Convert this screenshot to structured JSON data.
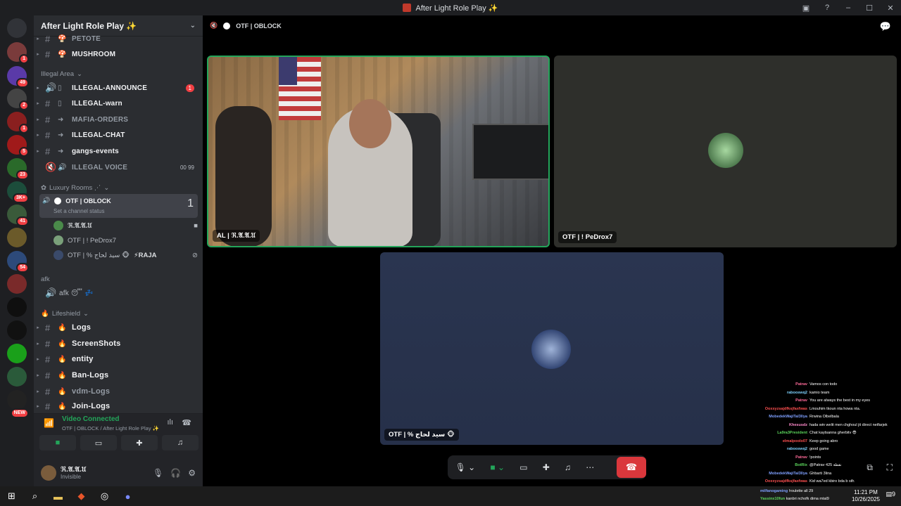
{
  "window": {
    "title": "After Light Role Play ✨"
  },
  "guild": {
    "name": "After Light Role Play ✨"
  },
  "servers": [
    {
      "badge": "1"
    },
    {
      "badge": "49"
    },
    {
      "badge": "2"
    },
    {
      "badge": "1"
    },
    {
      "badge": "5"
    },
    {
      "badge": "23"
    },
    {
      "badge": "3K+"
    },
    {
      "badge": "41"
    },
    {
      "badge": ""
    },
    {
      "badge": "54"
    },
    {
      "badge": ""
    },
    {
      "badge": ""
    },
    {
      "badge": ""
    },
    {
      "badge": ""
    },
    {
      "badge": "NEW"
    }
  ],
  "channels": {
    "top": [
      {
        "emoji": "🍄",
        "name": "PETOTE"
      },
      {
        "emoji": "🍄",
        "name": "MUSHROOM"
      }
    ],
    "illegal_category": "Illegal Area",
    "illegal": [
      {
        "name": "ILLEGAL-ANNOUNCE",
        "count": "1"
      },
      {
        "name": "ILLEGAL-warn",
        "count": ""
      },
      {
        "name": "MAFIA-ORDERS",
        "count": ""
      },
      {
        "name": "ILLEGAL-CHAT",
        "count": ""
      },
      {
        "name": "gangs-events",
        "count": ""
      },
      {
        "name": "ILLEGAL VOICE",
        "count": ""
      }
    ],
    "illegal_voice_counts": [
      "00",
      "99"
    ],
    "luxury_category": "Luxury Rooms ⋰",
    "current_voice": {
      "name": "OTF | OBLOCK",
      "status": "Set a channel status",
      "count": "1"
    },
    "voice_users": [
      {
        "name": "ℜ.𝔄.𝔄.𝔘"
      },
      {
        "name": "OTF | ! PeDrox7"
      },
      {
        "name": "OTF | % سيد لحاج 🐵",
        "extra": "⚡RAJA"
      }
    ],
    "afk_category": "afk",
    "afk": {
      "name": "afk 😴 💤"
    },
    "lifeshield_category": "Lifeshield",
    "lifeshield": [
      {
        "name": "Logs"
      },
      {
        "name": "ScreenShots"
      },
      {
        "name": "entity"
      },
      {
        "name": "Ban-Logs"
      },
      {
        "name": "vdm-Logs"
      },
      {
        "name": "Join-Logs"
      }
    ]
  },
  "voice_panel": {
    "status": "Video Connected",
    "where": "OTF | OBLOCK / After Light Role Play ✨"
  },
  "user": {
    "name": "ℜ.𝔄.𝔄.𝔘",
    "status": "Invisible"
  },
  "stage": {
    "header": "OTF | OBLOCK",
    "tiles": [
      {
        "label": "AL | ℜ.𝔄.𝔄.𝔘"
      },
      {
        "label": "OTF | ! PeDrox7"
      },
      {
        "label": "OTF | % سيد لحاج 🐵"
      }
    ]
  },
  "chat_overlay": [
    {
      "user": "Patrav",
      "text": "Vamos con todo"
    },
    {
      "user": "rabooswq2",
      "text": "kamio team"
    },
    {
      "user": "Patrav",
      "text": "You are always the best in my eyes"
    },
    {
      "user": "Ooxxyzsajdfksjfaxfwas",
      "text": "Lmouhim tkoun nta howa nta."
    },
    {
      "user": "MobedekWajiTal3llya",
      "text": "Rrwina Olbelbala"
    },
    {
      "user": "Khesusdz",
      "text": "hada win welit men chghoul jit direct netfarjek"
    },
    {
      "user": "La9ra3President",
      "text": "Chat kaytsanna gherbitv 😎"
    },
    {
      "user": "elmalpoolo07",
      "text": "Keep going abro"
    },
    {
      "user": "rabooswq2",
      "text": "good game"
    },
    {
      "user": "Patrav",
      "text": "!points"
    },
    {
      "user": "BotRix",
      "text": "@Patrav 425 نقطة"
    },
    {
      "user": "MobedekWajiTal3llya",
      "text": "Ghbarti 3lina"
    },
    {
      "user": "Ooxxyzsajdfksjfaxfwas",
      "text": "Kid wa7ed kbiro bda b sifr."
    },
    {
      "user": "milfanogaming",
      "text": "!roulette all 29"
    },
    {
      "user": "Yassinx10fun",
      "text": "kanbri nchofk dima mtal9"
    }
  ],
  "taskbar": {
    "time": "11:21 PM",
    "date": "10/26/2025",
    "notif": "9"
  },
  "colors": {
    "accent": "#23a55a",
    "danger": "#da373c",
    "blurple": "#5865f2"
  }
}
